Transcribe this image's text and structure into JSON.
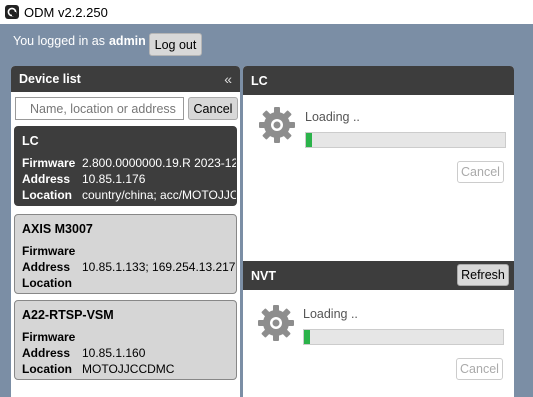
{
  "window": {
    "title": "ODM v2.2.250"
  },
  "login": {
    "prefix": "You logged in as",
    "user": "admin",
    "logout_label": "Log out"
  },
  "device_list": {
    "title": "Device list",
    "collapse_glyph": "«",
    "search_placeholder": "Name, location or address",
    "cancel_label": "Cancel",
    "field_labels": {
      "firmware": "Firmware",
      "address": "Address",
      "location": "Location"
    },
    "devices": [
      {
        "name": "LC",
        "firmware": "2.800.0000000.19.R 2023-12-",
        "address": "10.85.1.176",
        "location": "country/china; acc/MOTOJJC",
        "selected": true
      },
      {
        "name": "AXIS M3007",
        "firmware": "",
        "address": "10.85.1.133; 169.254.13.217",
        "location": "",
        "selected": false
      },
      {
        "name": "A22-RTSP-VSM",
        "firmware": "",
        "address": "10.85.1.160",
        "location": "MOTOJJCCDMC",
        "selected": false
      }
    ]
  },
  "panels": [
    {
      "title": "LC",
      "loading_text": "Loading ..",
      "progress": 0.01,
      "cancel_label": "Cancel"
    },
    {
      "title": "NVT",
      "refresh_label": "Refresh",
      "loading_text": "Loading ..",
      "progress": 0.01,
      "cancel_label": "Cancel"
    }
  ],
  "colors": {
    "header": "#3d3d3d",
    "background": "#7b8ea5",
    "progress_fill": "#2bb34a"
  },
  "icons": {
    "app": "odm-app-icon",
    "gear": "gear-icon",
    "collapse": "double-chevron-left-icon"
  }
}
